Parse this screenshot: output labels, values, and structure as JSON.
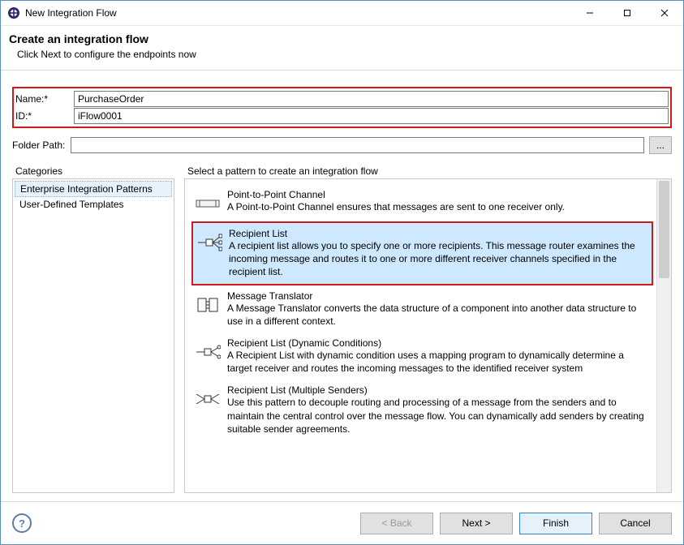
{
  "window": {
    "title": "New Integration Flow"
  },
  "header": {
    "title": "Create an integration flow",
    "subtitle": "Click Next to configure the endpoints now"
  },
  "form": {
    "name_label": "Name:*",
    "name_value": "PurchaseOrder",
    "id_label": "ID:*",
    "id_value": "iFlow0001",
    "folder_label": "Folder Path:",
    "folder_value": "",
    "browse_label": "..."
  },
  "categories": {
    "group_label": "Categories",
    "items": [
      {
        "label": "Enterprise Integration Patterns",
        "selected": true
      },
      {
        "label": "User-Defined Templates",
        "selected": false
      }
    ]
  },
  "patterns": {
    "group_label": "Select a pattern to create an integration flow",
    "items": [
      {
        "title": "Point-to-Point Channel",
        "desc": "A Point-to-Point Channel ensures that messages are sent to one receiver only.",
        "selected": false
      },
      {
        "title": "Recipient List",
        "desc": "A recipient list allows you to specify one or more recipients. This message router examines the incoming message and routes it to one or more different receiver channels specified in the recipient list.",
        "selected": true
      },
      {
        "title": "Message Translator",
        "desc": "A Message Translator converts the data structure of a component into another data structure to use in a different context.",
        "selected": false
      },
      {
        "title": "Recipient List (Dynamic Conditions)",
        "desc": "A Recipient List with dynamic condition uses a mapping program to dynamically determine a target receiver and routes the incoming messages to the identified receiver system",
        "selected": false
      },
      {
        "title": "Recipient List (Multiple Senders)",
        "desc": "Use this pattern to decouple routing and processing of a message from the senders and to maintain the central control over the message flow. You can dynamically add senders by creating suitable sender agreements.",
        "selected": false
      }
    ]
  },
  "footer": {
    "back": "< Back",
    "next": "Next >",
    "finish": "Finish",
    "cancel": "Cancel"
  }
}
